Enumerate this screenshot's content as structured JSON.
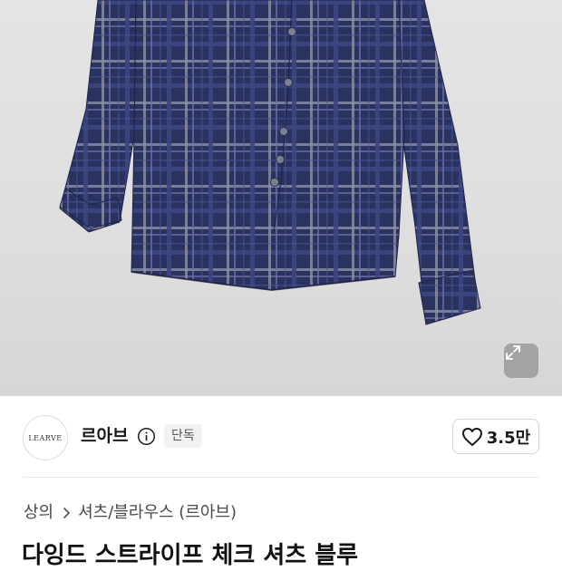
{
  "seller": {
    "logo_text": "LEARVE",
    "name": "르아브",
    "exclusive_badge": "단독"
  },
  "like": {
    "count": "3.5만"
  },
  "breadcrumb": {
    "level1": "상의",
    "level2": "셔츠/블라우스 (르아브)"
  },
  "product": {
    "title": "다잉드 스트라이프 체크 셔츠 블루"
  },
  "colors": {
    "shirt_base": "#2a3260",
    "background": "#e0e0e0"
  },
  "icons": {
    "expand": "expand-icon",
    "info": "info-icon",
    "heart": "heart-icon",
    "chevron": "chevron-right-icon"
  }
}
